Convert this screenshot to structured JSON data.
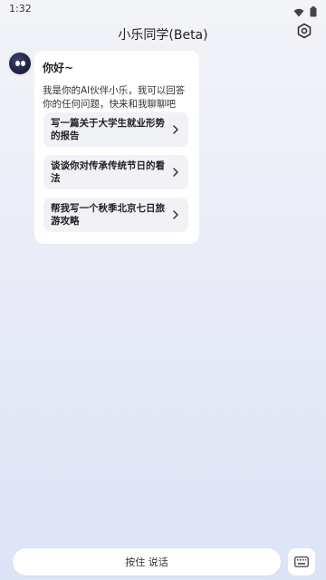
{
  "status_bar": {
    "time": "1:32",
    "icons": [
      "wifi-icon",
      "battery-icon"
    ]
  },
  "header": {
    "title": "小乐同学(Beta)",
    "settings_icon": "settings-icon"
  },
  "message": {
    "greeting": "你好~",
    "intro": "我是你的AI伙伴小乐，我可以回答你的任何问题，快来和我聊聊吧",
    "suggestions": [
      {
        "text": "写一篇关于大学生就业形势的报告"
      },
      {
        "text": "谈谈你对传承传统节日的看法"
      },
      {
        "text": "帮我写一个秋季北京七日旅游攻略"
      }
    ]
  },
  "bottom_bar": {
    "voice_label": "按住 说话",
    "keyboard_icon": "keyboard-icon"
  },
  "colors": {
    "card_bg": "#ffffff",
    "suggestion_bg": "#f1f2f6",
    "avatar_dark": "#1b1f3a"
  }
}
